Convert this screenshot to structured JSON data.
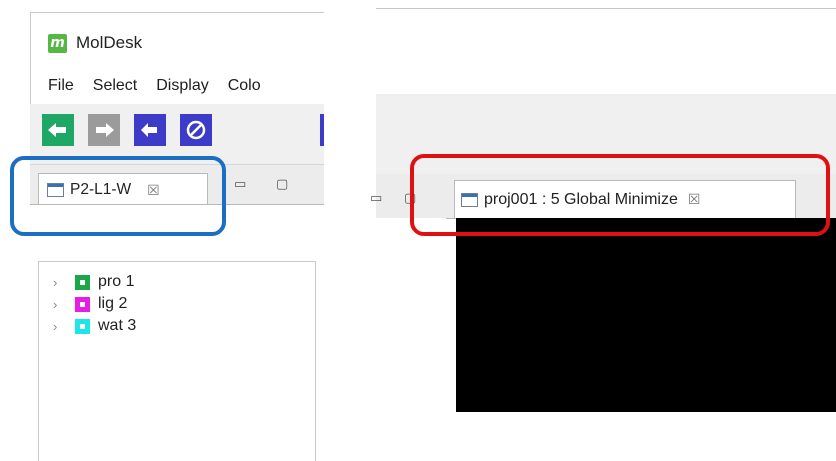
{
  "left_window": {
    "app_title": "MolDesk",
    "app_logo_letter": "m",
    "menu": [
      "File",
      "Select",
      "Display",
      "Colo"
    ],
    "toolbar_icons": [
      {
        "name": "arrow-left-icon",
        "bg": "#1fa865"
      },
      {
        "name": "arrow-right-icon",
        "bg": "#9b9b9b"
      },
      {
        "name": "arrow-back-icon",
        "bg": "#3c3cc8"
      },
      {
        "name": "prohibit-icon",
        "bg": "#3c3cc8"
      }
    ],
    "tab_label": "P2-L1-W",
    "tab_close_glyph": "☒",
    "tree_items": [
      {
        "label": "pro 1",
        "color": "#1ca64a"
      },
      {
        "label": "lig 2",
        "color": "#e61ee6"
      },
      {
        "label": "wat 3",
        "color": "#1ee6e6"
      }
    ]
  },
  "right_window": {
    "tab_label": "proj001 : 5 Global Minimize",
    "tab_close_glyph": "☒"
  },
  "highlights": {
    "blue": "#1b6fc2",
    "red": "#e01010"
  }
}
